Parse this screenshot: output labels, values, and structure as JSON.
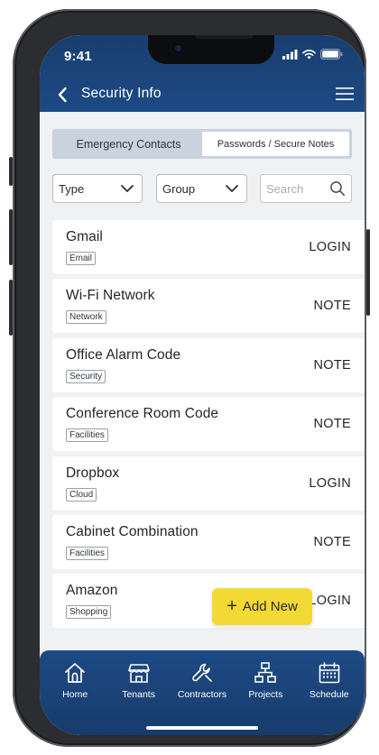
{
  "status_bar": {
    "time": "9:41"
  },
  "nav": {
    "title": "Security Info",
    "back_icon": "chevron-left-icon",
    "menu_icon": "hamburger-menu-icon"
  },
  "segments": [
    {
      "label": "Emergency Contacts",
      "active": false
    },
    {
      "label": "Passwords / Secure Notes",
      "active": true
    }
  ],
  "filters": {
    "type": {
      "value": "Type"
    },
    "group": {
      "value": "Group"
    },
    "search": {
      "placeholder": "Search"
    }
  },
  "entries": [
    {
      "title": "Gmail",
      "tag": "Email",
      "type": "LOGIN"
    },
    {
      "title": "Wi-Fi Network",
      "tag": "Network",
      "type": "NOTE"
    },
    {
      "title": "Office Alarm Code",
      "tag": "Security",
      "type": "NOTE"
    },
    {
      "title": "Conference Room Code",
      "tag": "Facilities",
      "type": "NOTE"
    },
    {
      "title": "Dropbox",
      "tag": "Cloud",
      "type": "LOGIN"
    },
    {
      "title": "Cabinet Combination",
      "tag": "Facilities",
      "type": "NOTE"
    },
    {
      "title": "Amazon",
      "tag": "Shopping",
      "type": "LOGIN"
    }
  ],
  "fab": {
    "label": "Add New",
    "icon": "plus-icon"
  },
  "bottom_nav": [
    {
      "label": "Home",
      "icon": "home-icon"
    },
    {
      "label": "Tenants",
      "icon": "storefront-icon"
    },
    {
      "label": "Contractors",
      "icon": "wrench-icon"
    },
    {
      "label": "Projects",
      "icon": "sitemap-icon"
    },
    {
      "label": "Schedule",
      "icon": "calendar-icon"
    }
  ],
  "colors": {
    "header": "#1d4a84",
    "accent_fab": "#f3d936",
    "segment_bg": "#c9d3e0",
    "content_bg": "#f0f1f3"
  }
}
